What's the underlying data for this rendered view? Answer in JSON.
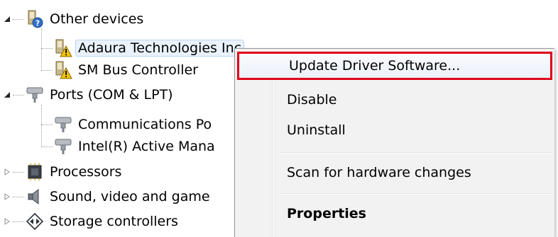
{
  "tree": {
    "categories": [
      {
        "label": "Other devices",
        "expanded": true,
        "icon": "unknown-device-icon",
        "children": [
          {
            "label": "Adaura Technologies Inc",
            "icon": "warning-device-icon",
            "selected": true
          },
          {
            "label": "SM Bus Controller",
            "icon": "warning-device-icon",
            "selected": false
          }
        ]
      },
      {
        "label": "Ports (COM & LPT)",
        "expanded": true,
        "icon": "port-icon",
        "children": [
          {
            "label": "Communications Po",
            "icon": "port-icon",
            "selected": false
          },
          {
            "label": "Intel(R) Active Mana",
            "icon": "port-icon",
            "selected": false
          }
        ]
      },
      {
        "label": "Processors",
        "expanded": false,
        "icon": "processor-icon"
      },
      {
        "label": "Sound, video and game",
        "expanded": false,
        "icon": "speaker-icon"
      },
      {
        "label": "Storage controllers",
        "expanded": false,
        "icon": "storage-controller-icon"
      }
    ]
  },
  "context_menu": {
    "items": [
      {
        "label": "Update Driver Software...",
        "highlighted": true,
        "bold": false
      },
      {
        "label": "Disable",
        "highlighted": false,
        "bold": false
      },
      {
        "label": "Uninstall",
        "highlighted": false,
        "bold": false
      },
      {
        "label": "Scan for hardware changes",
        "highlighted": false,
        "bold": false
      },
      {
        "label": "Properties",
        "highlighted": false,
        "bold": true
      }
    ]
  },
  "colors": {
    "highlight_border": "#e0001b",
    "menu_background": "#f2f2f2",
    "selection_background": "#eaf2fb"
  }
}
